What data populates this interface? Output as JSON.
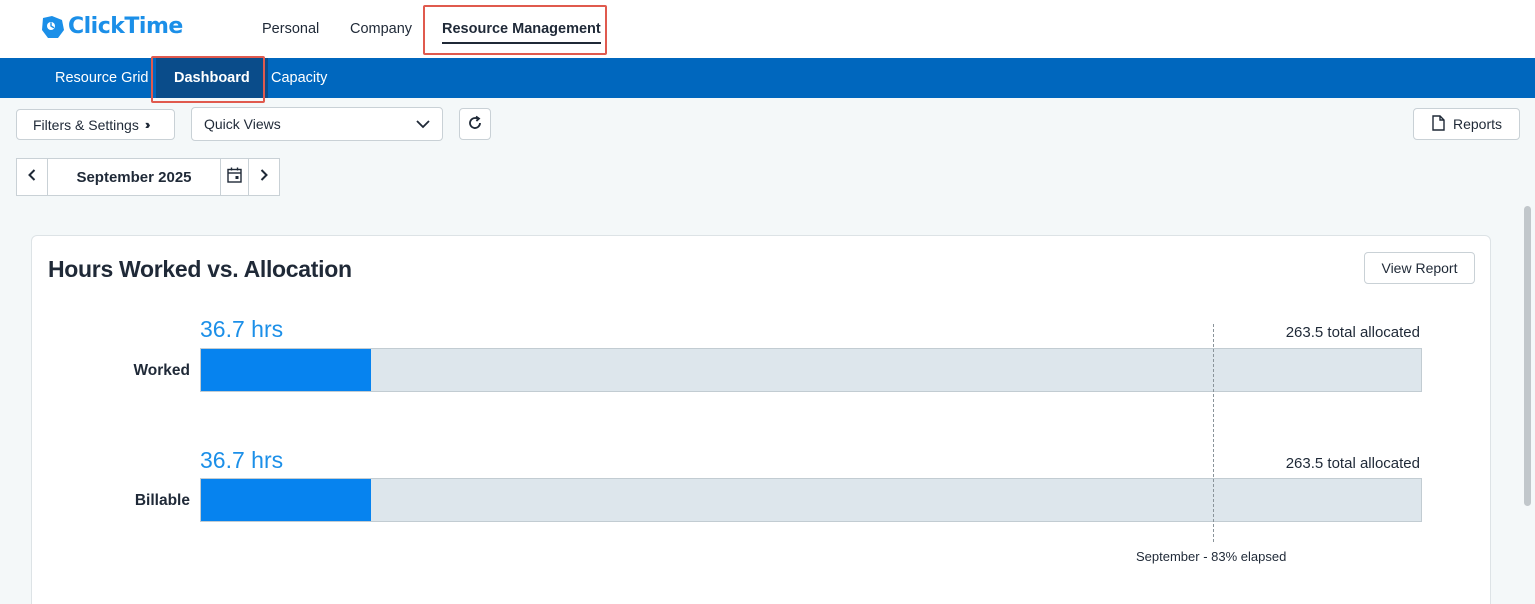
{
  "app": {
    "logo_text": "ClickTime",
    "brand_color": "#1b8fe8"
  },
  "topnav": {
    "items": [
      {
        "label": "Personal"
      },
      {
        "label": "Company"
      },
      {
        "label": "Resource Management",
        "active": true
      }
    ]
  },
  "subnav": {
    "items": [
      {
        "label": "Resource Grid"
      },
      {
        "label": "Dashboard",
        "active": true
      },
      {
        "label": "Capacity"
      }
    ]
  },
  "toolbar": {
    "filters_label": "Filters & Settings",
    "quick_views_label": "Quick Views",
    "refresh_icon": "refresh-icon",
    "reports_label": "Reports"
  },
  "month_picker": {
    "label": "September 2025"
  },
  "card": {
    "title": "Hours Worked vs. Allocation",
    "view_report_label": "View Report",
    "rows": [
      {
        "label": "Worked",
        "hours": "36.7 hrs",
        "total": "263.5 total allocated",
        "value": 36.7,
        "max": 263.5
      },
      {
        "label": "Billable",
        "hours": "36.7 hrs",
        "total": "263.5 total allocated",
        "value": 36.7,
        "max": 263.5
      }
    ],
    "elapsed_label": "September - 83% elapsed",
    "elapsed_fraction": 0.83
  }
}
